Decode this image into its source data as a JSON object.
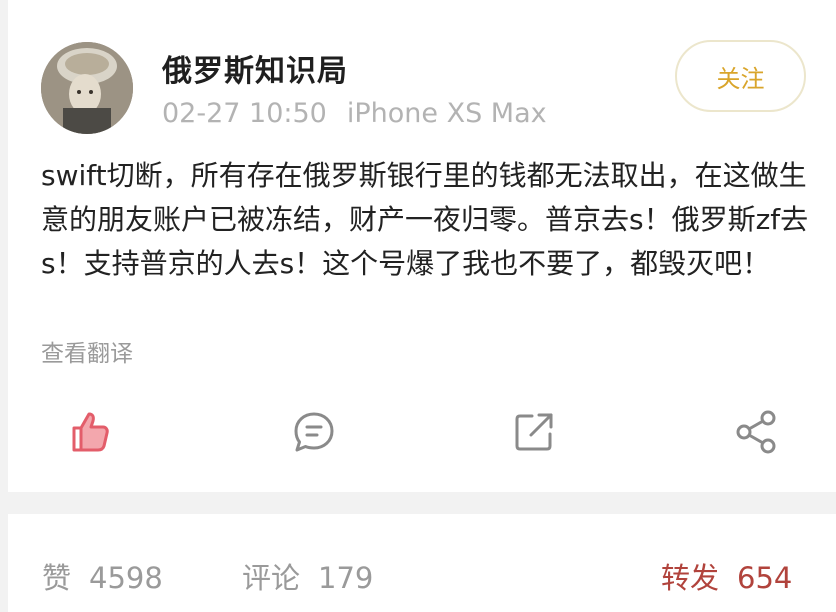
{
  "post": {
    "username": "俄罗斯知识局",
    "timestamp": "02-27 10:50",
    "device": "iPhone XS Max",
    "follow_label": "关注",
    "text": "swift切断，所有存在俄罗斯银行里的钱都无法取出，在这做生意的朋友账户已被冻结，财产一夜归零。普京去s！俄罗斯zf去s！支持普京的人去s！这个号爆了我也不要了，都毁灭吧！",
    "translate_label": "查看翻译"
  },
  "actions": {
    "like_icon": "thumbs-up-icon",
    "comment_icon": "comment-bubble-icon",
    "share_icon": "share-external-icon",
    "more_icon": "share-nodes-icon"
  },
  "stats": {
    "likes_label": "赞",
    "likes_count": "4598",
    "comments_label": "评论",
    "comments_count": "179",
    "reposts_label": "转发",
    "reposts_count": "654"
  },
  "colors": {
    "accent_gold": "#d9a52b",
    "like_pink": "#e35d6a",
    "repost_red": "#b1433c",
    "muted_gray": "#9a9a9a"
  }
}
